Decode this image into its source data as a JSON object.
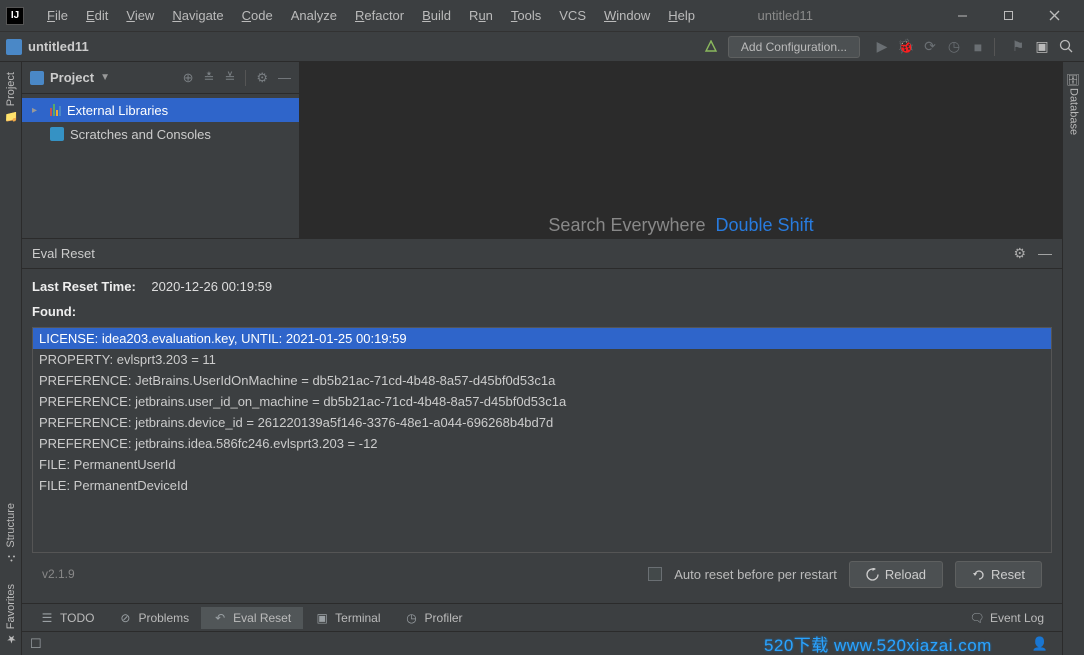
{
  "window": {
    "title": "untitled11",
    "project_name": "untitled11"
  },
  "menu": {
    "items": [
      "File",
      "Edit",
      "View",
      "Navigate",
      "Code",
      "Analyze",
      "Refactor",
      "Build",
      "Run",
      "Tools",
      "VCS",
      "Window",
      "Help"
    ]
  },
  "toolbar": {
    "add_configuration": "Add Configuration..."
  },
  "project_tool": {
    "title": "Project",
    "tree": {
      "external_libraries": "External Libraries",
      "scratches": "Scratches and Consoles"
    }
  },
  "editor_placeholder": {
    "text": "Search Everywhere",
    "shortcut": "Double Shift"
  },
  "eval_reset": {
    "title": "Eval Reset",
    "last_reset_label": "Last Reset Time:",
    "last_reset_value": "2020-12-26 00:19:59",
    "found_label": "Found:",
    "items": [
      "LICENSE: idea203.evaluation.key, UNTIL: 2021-01-25 00:19:59",
      "PROPERTY: evlsprt3.203 = 11",
      "PREFERENCE: JetBrains.UserIdOnMachine = db5b21ac-71cd-4b48-8a57-d45bf0d53c1a",
      "PREFERENCE: jetbrains.user_id_on_machine = db5b21ac-71cd-4b48-8a57-d45bf0d53c1a",
      "PREFERENCE: jetbrains.device_id = 261220139a5f146-3376-48e1-a044-696268b4bd7d",
      "PREFERENCE: jetbrains.idea.586fc246.evlsprt3.203 = -12",
      "FILE: PermanentUserId",
      "FILE: PermanentDeviceId"
    ],
    "version": "v2.1.9",
    "auto_reset_label": "Auto reset before per restart",
    "reload_btn": "Reload",
    "reset_btn": "Reset"
  },
  "bottom_tabs": {
    "todo": "TODO",
    "problems": "Problems",
    "eval_reset": "Eval Reset",
    "terminal": "Terminal",
    "profiler": "Profiler",
    "event_log": "Event Log"
  },
  "sidebars": {
    "project": "Project",
    "structure": "Structure",
    "favorites": "Favorites",
    "database": "Database"
  },
  "watermark": {
    "text": "520下载 www.520xiazai.com"
  },
  "colors": {
    "bg": "#3c3f41",
    "editor_bg": "#2b2b2b",
    "selection": "#2f65ca",
    "link": "#287bde"
  }
}
